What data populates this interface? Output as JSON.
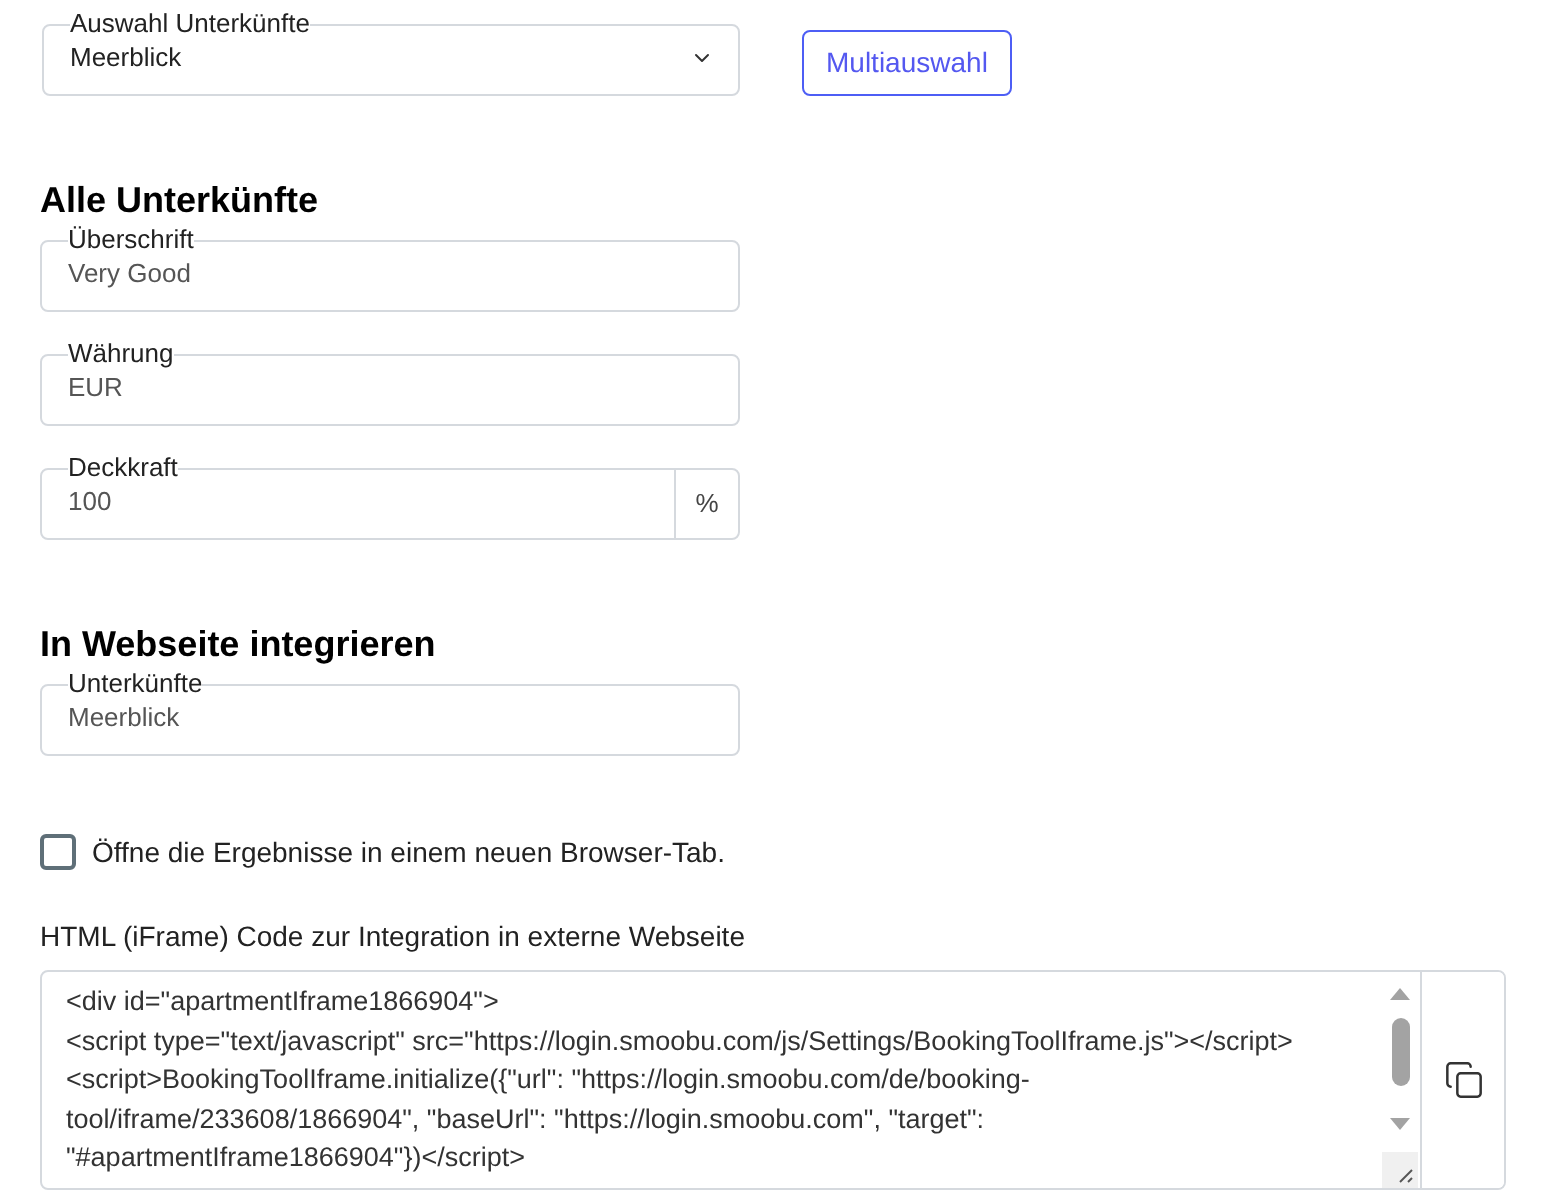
{
  "accommodation_select": {
    "label": "Auswahl Unterkünfte",
    "value": "Meerblick"
  },
  "multi_select_button": {
    "label": "Multiauswahl"
  },
  "all_accommodations": {
    "heading": "Alle Unterkünfte",
    "fields": [
      {
        "kind": "text",
        "label": "Überschrift",
        "value": "Very Good"
      },
      {
        "kind": "text",
        "label": "Währung",
        "value": "EUR"
      },
      {
        "kind": "addon",
        "label": "Deckkraft",
        "value": "100",
        "addon": "%"
      }
    ]
  },
  "embed": {
    "heading": "In Webseite integrieren",
    "fields": [
      {
        "kind": "text",
        "label": "Unterkünfte",
        "value": "Meerblick"
      }
    ],
    "new_tab_checkbox": {
      "label": "Öffne die Ergebnisse in einem neuen Browser-Tab.",
      "checked": false
    },
    "code_label": "HTML (iFrame) Code zur Integration in externe Webseite",
    "code": "<div id=\"apartmentIframe1866904\">\n<script type=\"text/javascript\" src=\"https://login.smoobu.com/js/Settings/BookingToolIframe.js\"></script>\n<script>BookingToolIframe.initialize({\"url\": \"https://login.smoobu.com/de/booking-tool/iframe/233608/1866904\", \"baseUrl\": \"https://login.smoobu.com\", \"target\": \"#apartmentIframe1866904\"})</script>"
  }
}
